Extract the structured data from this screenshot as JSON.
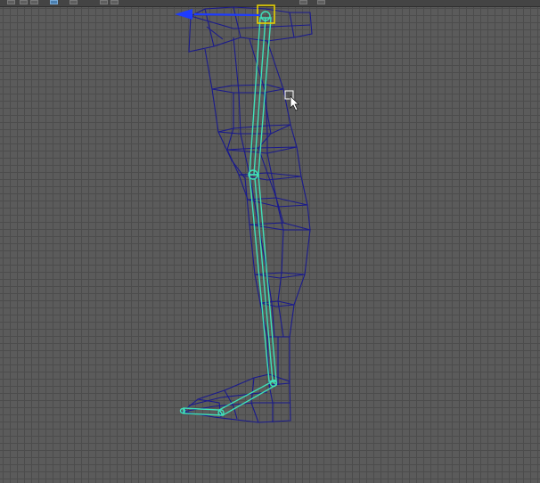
{
  "app": {
    "name": "3D viewport"
  },
  "colors": {
    "viewport_bg": "#5b5b5b",
    "grid_line": "#4c4c4c",
    "mesh_wire": "#1a1a8c",
    "bone": "#3fe0b8",
    "selection_box": "#e6d000",
    "move_axis": "#1e3cff"
  },
  "toolbar": {
    "tools": [
      {
        "icon": "file-icon"
      },
      {
        "icon": "undo-icon"
      },
      {
        "icon": "redo-icon"
      },
      {
        "icon": "select-icon",
        "active": true
      },
      {
        "icon": "move-icon"
      },
      {
        "icon": "rotate-icon"
      },
      {
        "icon": "scale-icon"
      },
      {
        "icon": "snap-icon"
      },
      {
        "icon": "render-icon"
      }
    ]
  },
  "scene": {
    "object": "leg-mesh",
    "skeleton": [
      "hip-joint",
      "knee-joint",
      "ankle-joint",
      "toe-joint"
    ],
    "selected": "hip-joint",
    "gizmo": "move-arrow-x"
  }
}
